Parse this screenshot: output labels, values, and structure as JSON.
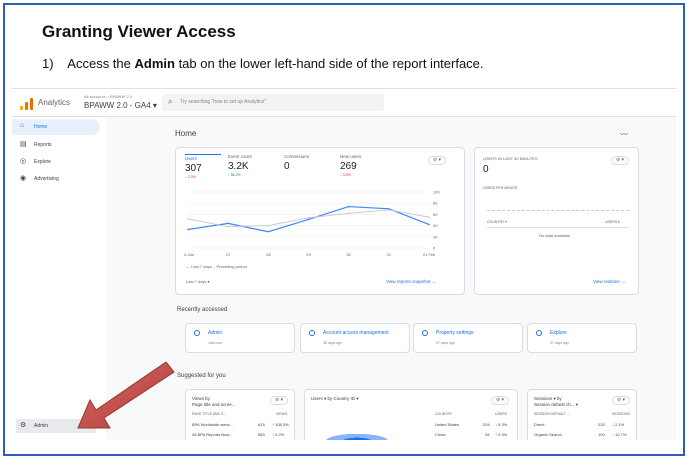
{
  "doc": {
    "title": "Granting Viewer Access",
    "step_num": "1)",
    "step_pre": "Access the ",
    "step_bold": "Admin",
    "step_post": " tab on the lower left-hand side of the report interface."
  },
  "app": {
    "name": "Analytics",
    "breadcrumb": "All accounts > BPAWW 2.0",
    "property": "BPAWW 2.0 - GA4",
    "search_placeholder": "Try searching \"how to set up Analytics\""
  },
  "nav": {
    "items": [
      {
        "icon": "home-icon",
        "label": "Home"
      },
      {
        "icon": "reports-icon",
        "label": "Reports"
      },
      {
        "icon": "explore-icon",
        "label": "Explore"
      },
      {
        "icon": "advertising-icon",
        "label": "Advertising"
      }
    ],
    "admin": "Admin"
  },
  "home": {
    "title": "Home",
    "metrics": [
      {
        "label": "Users",
        "value": "307",
        "delta": "↓ 2.3%",
        "dir": "down"
      },
      {
        "label": "Event count",
        "value": "3.2K",
        "delta": "↑ 56.2%",
        "dir": "up"
      },
      {
        "label": "Conversions",
        "value": "0",
        "delta": "",
        "dir": ""
      },
      {
        "label": "New users",
        "value": "269",
        "delta": "↓ 3.9%",
        "dir": "down"
      }
    ],
    "legend_current": "Last 7 days",
    "legend_previous": "Preceding period",
    "date_range": "Last 7 days ▾",
    "view_snapshot": "View reports snapshot →"
  },
  "chart_data": {
    "type": "line",
    "x": [
      "26 Jan",
      "27",
      "28",
      "29",
      "30",
      "31",
      "01 Feb"
    ],
    "series": [
      {
        "name": "Last 7 days",
        "values": [
          33,
          44,
          29,
          51,
          74,
          70,
          42
        ]
      },
      {
        "name": "Preceding period",
        "values": [
          52,
          38,
          40,
          54,
          62,
          68,
          55
        ]
      }
    ],
    "yticks": [
      "0",
      "20",
      "40",
      "60",
      "80",
      "100"
    ],
    "ylim": [
      0,
      100
    ]
  },
  "realtime": {
    "title": "USERS IN LAST 30 MINUTES",
    "value": "0",
    "sub": "USERS PER MINUTE",
    "col1": "COUNTRY ▾",
    "col2": "USERS ▾",
    "empty": "No data available",
    "link": "View realtime →"
  },
  "recent": {
    "title": "Recently accessed",
    "items": [
      {
        "label": "Admin",
        "sub": "Just now"
      },
      {
        "label": "Account access management",
        "sub": "36 days ago"
      },
      {
        "label": "Property settings",
        "sub": "37 days ago"
      },
      {
        "label": "Explore",
        "sub": "37 days ago"
      }
    ]
  },
  "suggested": {
    "title": "Suggested for you",
    "card1": {
      "title1": "Views by",
      "title2": "Page title and scree...",
      "col1": "PAGE TITLE AND S...",
      "col2": "VIEWS",
      "rows": [
        {
          "name": "BPA Worldwide webs...",
          "value": "615",
          "delta": "↑ 108.3%"
        },
        {
          "name": "All BPA Reports Now...",
          "value": "583",
          "delta": "↑ 0.2%"
        }
      ]
    },
    "card2": {
      "title": "Users ▾ by Country ID ▾",
      "col1": "COUNTRY",
      "col2": "USERS",
      "rows": [
        {
          "name": "United States",
          "value": "204",
          "delta": "↓ 9.3%"
        },
        {
          "name": "China",
          "value": "28",
          "delta": "↑ 9.3%"
        }
      ]
    },
    "card3": {
      "title1": "Sessions ▾ by",
      "title2": "Session default ch... ▾",
      "col1": "SESSION DEFAULT ...",
      "col2": "SESSIONS",
      "rows": [
        {
          "name": "Direct",
          "value": "233",
          "delta": "↓ 2.1%"
        },
        {
          "name": "Organic Search",
          "value": "100",
          "delta": "↓ 10.7%"
        }
      ]
    }
  },
  "colors": {
    "frame": "#2f5eb8",
    "accent": "#1a73e8",
    "arrow": "#c0504d",
    "current": "#4285f4",
    "previous": "#c4c7cc"
  }
}
